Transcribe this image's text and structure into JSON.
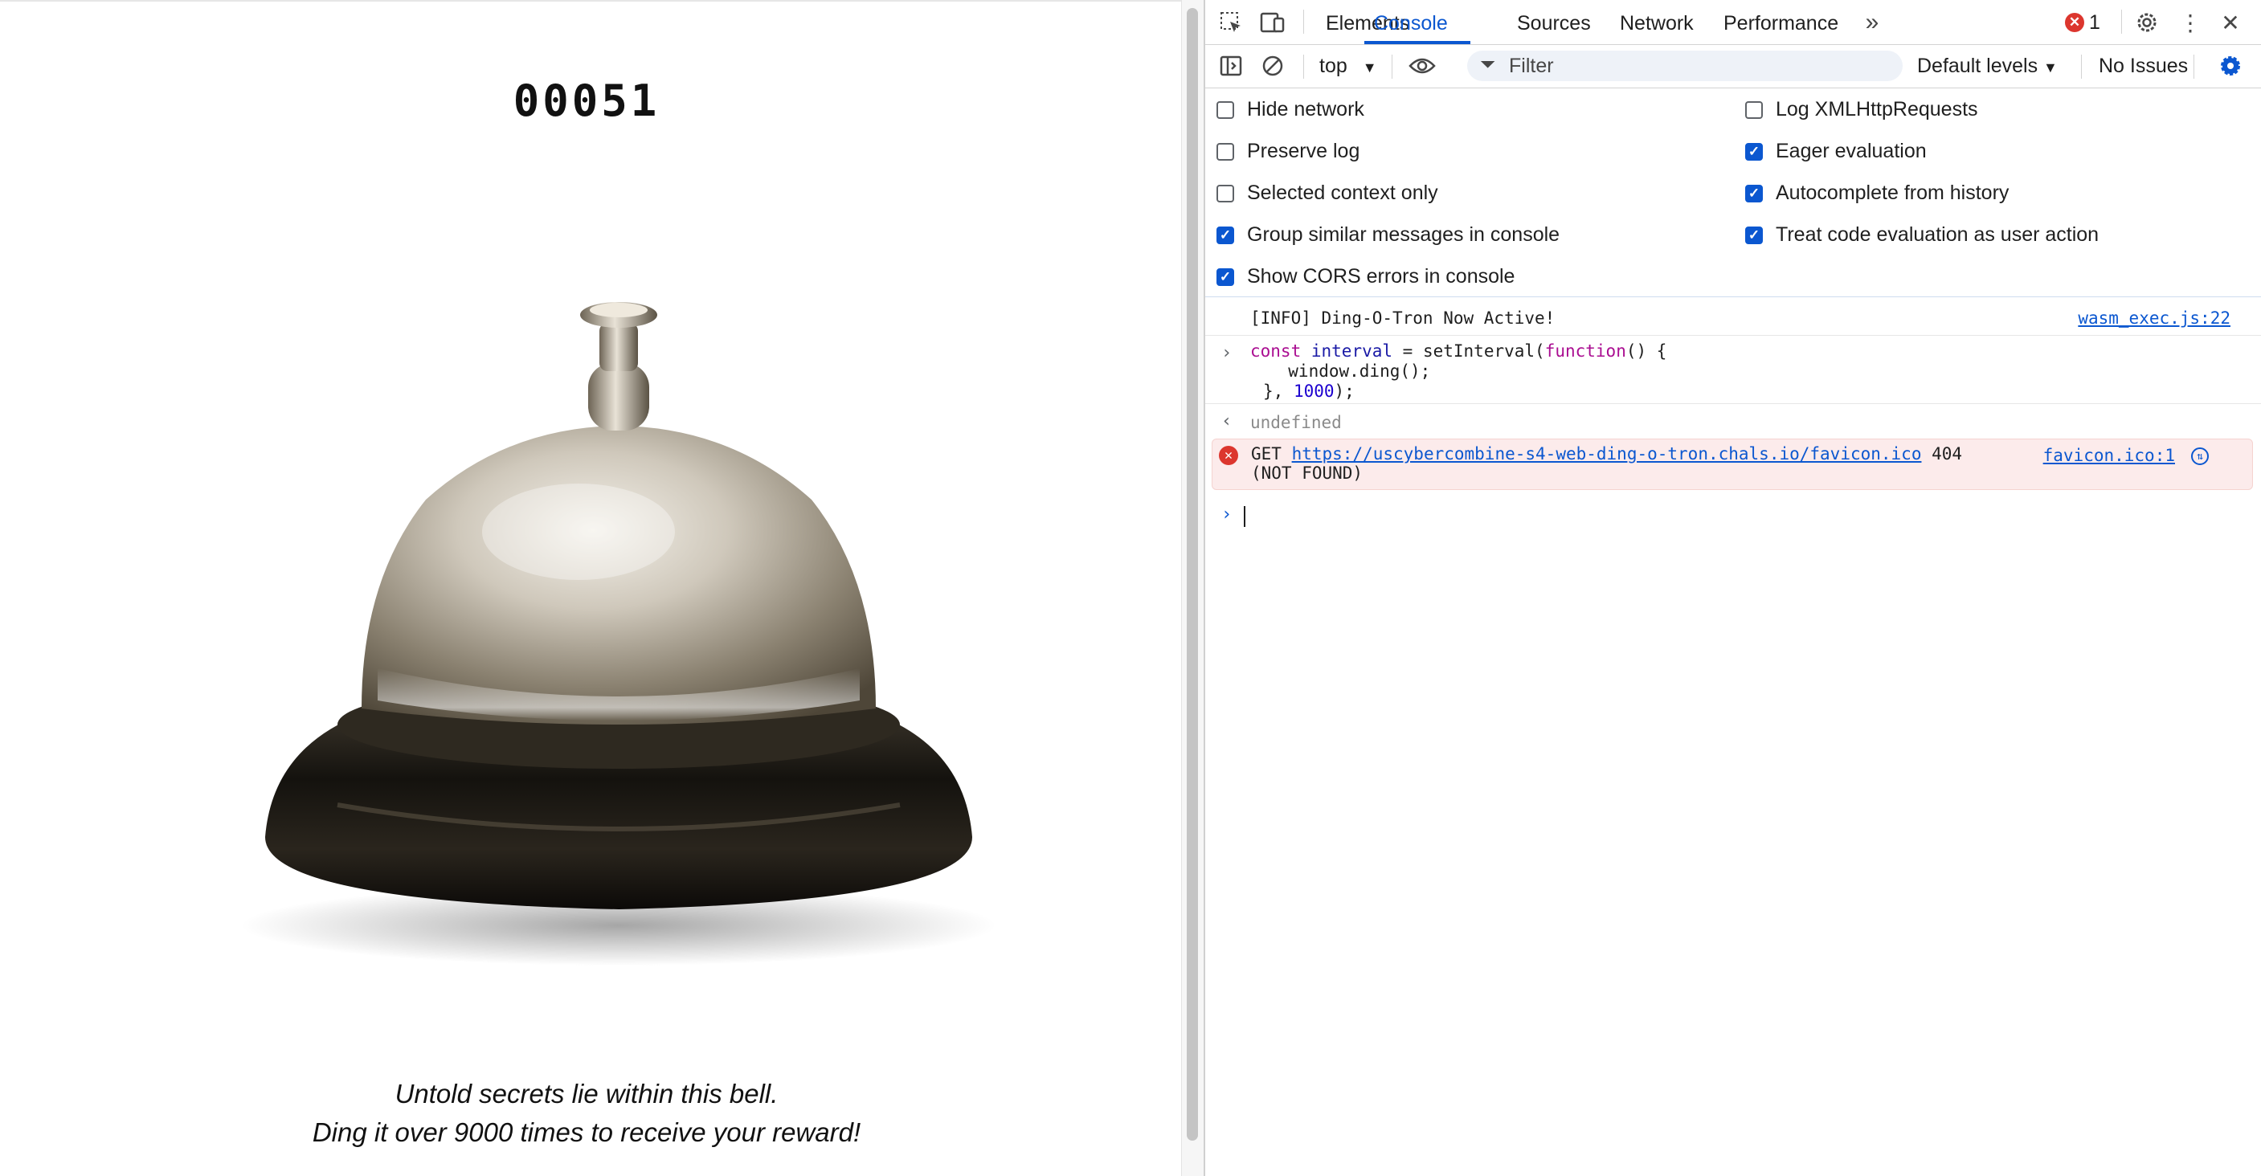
{
  "page": {
    "counter": "00051",
    "caption_line1": "Untold secrets lie within this bell.",
    "caption_line2": "Ding it over 9000 times to receive your reward!"
  },
  "devtools": {
    "tabs": [
      "Elements",
      "Console",
      "Sources",
      "Network",
      "Performance"
    ],
    "active_tab": "Console",
    "more_tabs_icon": "chevron-double-right-icon",
    "error_count": "1",
    "toolbar": {
      "context": "top",
      "filter_placeholder": "Filter",
      "levels": "Default levels",
      "issues": "No Issues"
    },
    "settings": [
      {
        "label": "Hide network",
        "checked": false
      },
      {
        "label": "Log XMLHttpRequests",
        "checked": false
      },
      {
        "label": "Preserve log",
        "checked": false
      },
      {
        "label": "Eager evaluation",
        "checked": true
      },
      {
        "label": "Selected context only",
        "checked": false
      },
      {
        "label": "Autocomplete from history",
        "checked": true
      },
      {
        "label": "Group similar messages in console",
        "checked": true
      },
      {
        "label": "Treat code evaluation as user action",
        "checked": true
      },
      {
        "label": "Show CORS errors in console",
        "checked": true
      }
    ],
    "console": {
      "info_text": "[INFO] Ding-O-Tron Now Active!",
      "info_source": "wasm_exec.js:22",
      "input_line1_a": "const",
      "input_line1_b": "interval",
      "input_line1_c": " = setInterval(",
      "input_line1_d": "function",
      "input_line1_e": "() {",
      "input_line2": "  window.ding();",
      "input_line3_a": "}, ",
      "input_line3_b": "1000",
      "input_line3_c": ");",
      "result": "undefined",
      "error_method": "GET",
      "error_url": "https://uscybercombine-s4-web-ding-o-tron.chals.io/favicon.ico",
      "error_status": "404",
      "error_status_text": "(NOT FOUND)",
      "error_source": "favicon.ico:1"
    }
  },
  "colors": {
    "accent": "#0b57d0",
    "error": "#dc362e",
    "error_bg": "#fcebeb"
  }
}
